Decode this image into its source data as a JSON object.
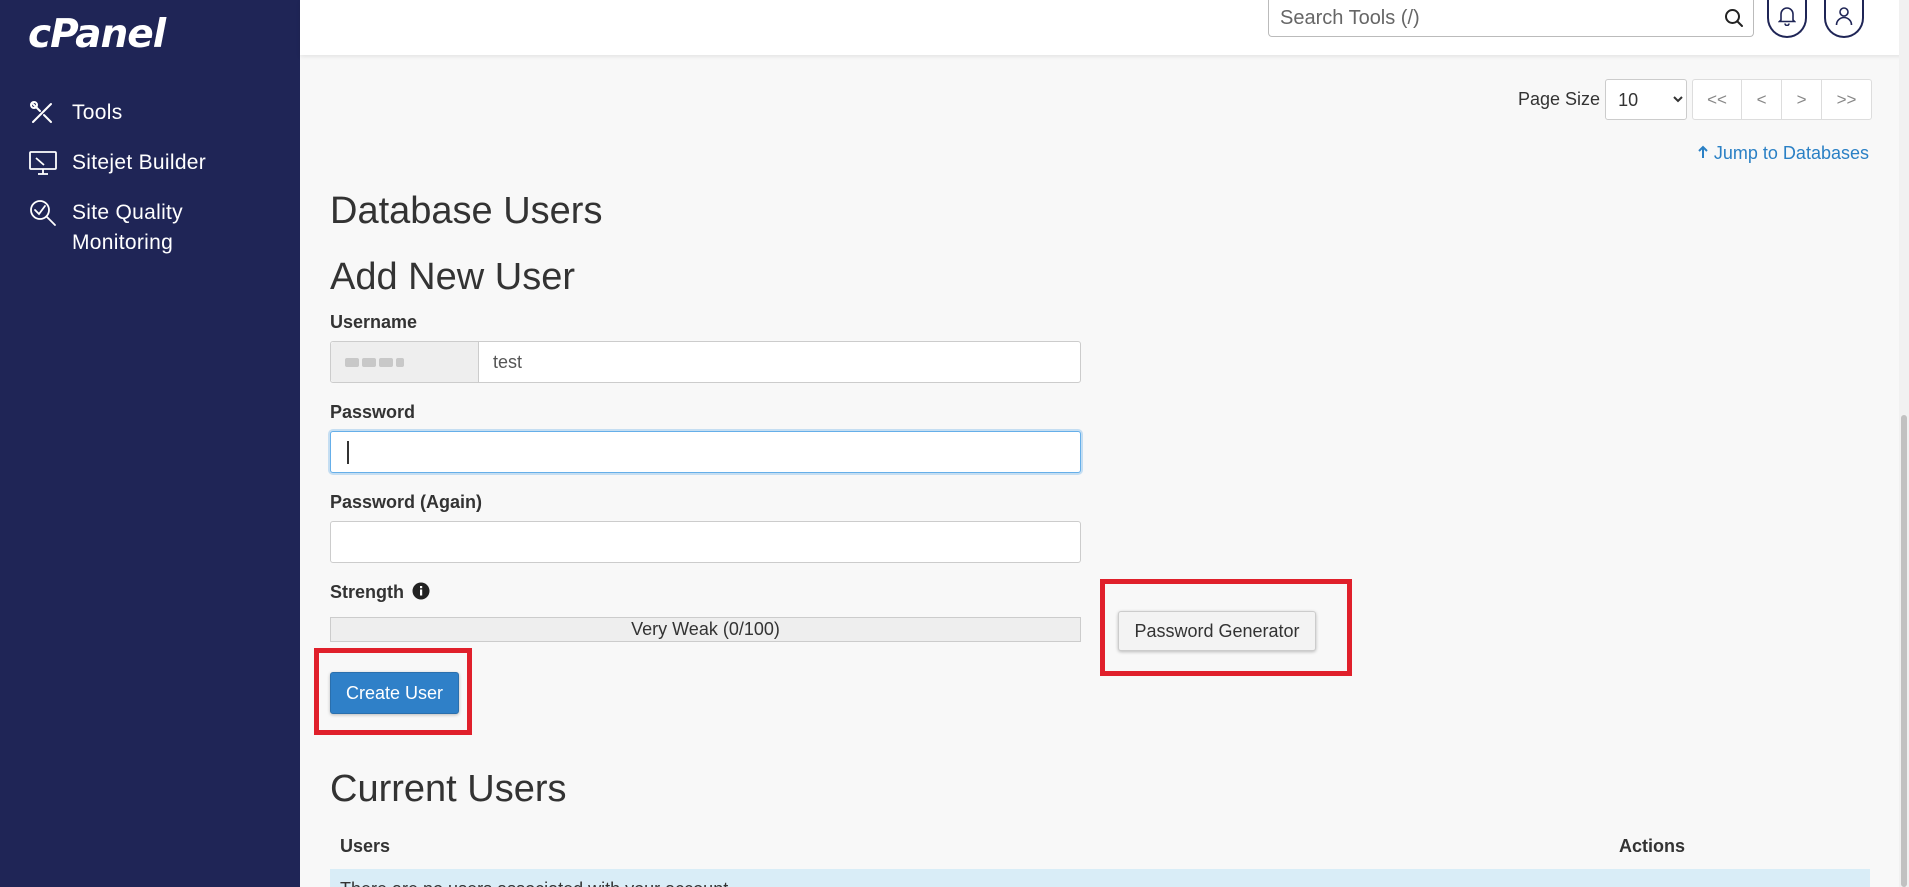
{
  "sidebar": {
    "logo": "cPanel",
    "items": [
      {
        "label": "Tools",
        "icon": "tools-icon"
      },
      {
        "label": "Sitejet Builder",
        "icon": "monitor-icon"
      },
      {
        "label": "Site Quality Monitoring",
        "icon": "magnifier-check-icon"
      }
    ]
  },
  "topbar": {
    "search_placeholder": "Search Tools (/)"
  },
  "pagination": {
    "page_size_label": "Page Size",
    "page_size_value": "10",
    "buttons": [
      "<<",
      "<",
      ">",
      ">>"
    ]
  },
  "jump_link": "Jump to Databases",
  "database_users_title": "Database Users",
  "add_user": {
    "title": "Add New User",
    "username_label": "Username",
    "username_value": "test",
    "password_label": "Password",
    "password_again_label": "Password (Again)",
    "strength_label": "Strength",
    "strength_value": "Very Weak (0/100)",
    "password_generator_label": "Password Generator",
    "create_user_label": "Create User"
  },
  "current_users": {
    "title": "Current Users",
    "columns": [
      "Users",
      "Actions"
    ],
    "row_text": "There are no users associated with your account."
  },
  "colors": {
    "sidebar_bg": "#1f2556",
    "primary": "#2f80c8",
    "highlight": "#e0202b",
    "link": "#2a80c5"
  }
}
